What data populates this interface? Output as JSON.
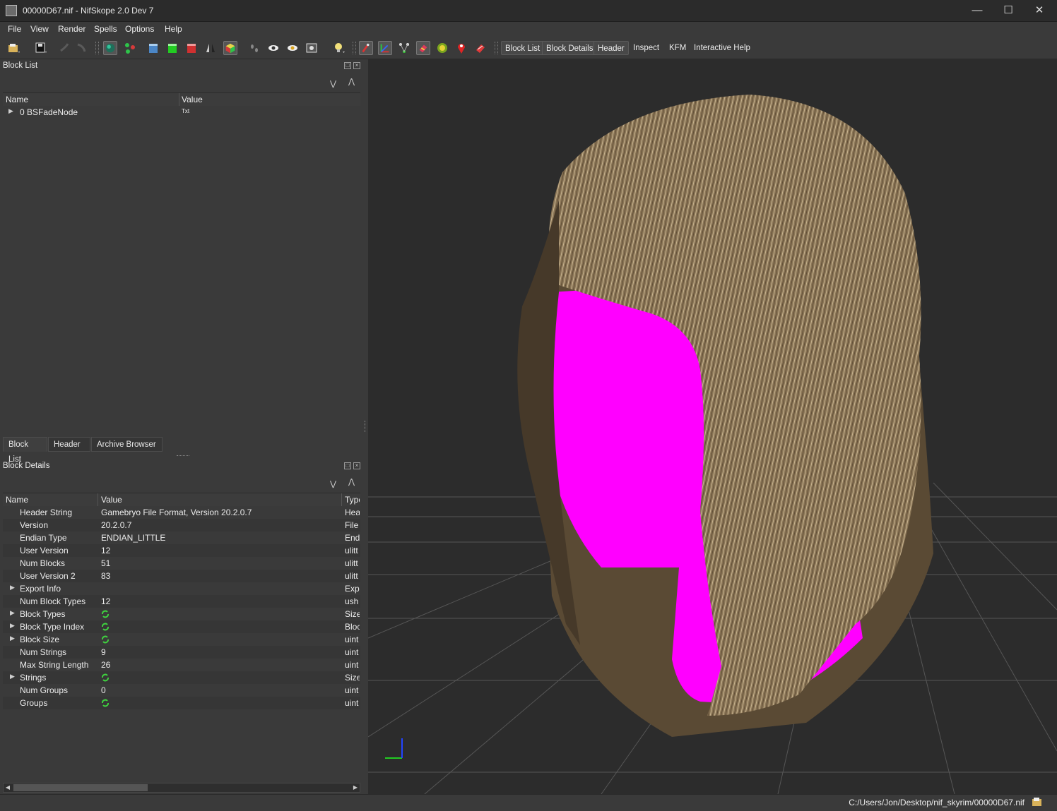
{
  "window": {
    "title": "00000D67.nif - NifSkope 2.0 Dev 7"
  },
  "menu": [
    "File",
    "View",
    "Render",
    "Spells",
    "Options",
    "Help"
  ],
  "toolbar": {
    "text_buttons": [
      "Block List",
      "Block Details",
      "Header",
      "Inspect",
      "KFM",
      "Interactive Help"
    ],
    "icons": [
      "open-icon",
      "save-icon",
      "undo-icon",
      "redo-icon",
      "globe-icon",
      "nodes-icon",
      "cube-front-icon",
      "cube-green-icon",
      "cube-red-icon",
      "flip-icon",
      "cube-color-icon",
      "footprints-icon",
      "eye-icon",
      "eye-yellow-icon",
      "camera-icon",
      "lightbulb-icon",
      "select-tool-icon",
      "axes-icon",
      "vertices-icon",
      "eraser-icon",
      "sphere-icon",
      "marker-icon",
      "shape-icon"
    ]
  },
  "block_list": {
    "title": "Block List",
    "columns": [
      "Name",
      "Value"
    ],
    "rows": [
      {
        "name": "0 BSFadeNode",
        "value": "Txt"
      }
    ]
  },
  "tabs": [
    "Block List",
    "Header",
    "Archive Browser"
  ],
  "block_details": {
    "title": "Block Details",
    "columns": [
      "Name",
      "Value",
      "Type"
    ],
    "rows": [
      {
        "name": "Header String",
        "value": "Gamebryo File Format, Version 20.2.0.7",
        "type": "Hea",
        "expandable": false,
        "icon": false
      },
      {
        "name": "Version",
        "value": "20.2.0.7",
        "type": "File",
        "expandable": false,
        "icon": false
      },
      {
        "name": "Endian Type",
        "value": "ENDIAN_LITTLE",
        "type": "End",
        "expandable": false,
        "icon": false
      },
      {
        "name": "User Version",
        "value": "12",
        "type": "ulitt",
        "expandable": false,
        "icon": false
      },
      {
        "name": "Num Blocks",
        "value": "51",
        "type": "ulitt",
        "expandable": false,
        "icon": false
      },
      {
        "name": "User Version 2",
        "value": "83",
        "type": "ulitt",
        "expandable": false,
        "icon": false
      },
      {
        "name": "Export Info",
        "value": "",
        "type": "Exp",
        "expandable": true,
        "icon": false
      },
      {
        "name": "Num Block Types",
        "value": "12",
        "type": "ush",
        "expandable": false,
        "icon": false
      },
      {
        "name": "Block Types",
        "value": "",
        "type": "Size",
        "expandable": true,
        "icon": true
      },
      {
        "name": "Block Type Index",
        "value": "",
        "type": "Bloc",
        "expandable": true,
        "icon": true
      },
      {
        "name": "Block Size",
        "value": "",
        "type": "uint",
        "expandable": true,
        "icon": true
      },
      {
        "name": "Num Strings",
        "value": "9",
        "type": "uint",
        "expandable": false,
        "icon": false
      },
      {
        "name": "Max String Length",
        "value": "26",
        "type": "uint",
        "expandable": false,
        "icon": false
      },
      {
        "name": "Strings",
        "value": "",
        "type": "Size",
        "expandable": true,
        "icon": true
      },
      {
        "name": "Num Groups",
        "value": "0",
        "type": "uint",
        "expandable": false,
        "icon": false
      },
      {
        "name": "Groups",
        "value": "",
        "type": "uint",
        "expandable": false,
        "icon": true
      }
    ]
  },
  "status": {
    "path": "C:/Users/Jon/Desktop/nif_skyrim/00000D67.nif"
  },
  "colors": {
    "viewport_bg": "#2c2c2c",
    "face": "#ff00ff",
    "hair": "#8a7556",
    "axis_x": "#22cc22",
    "axis_z": "#2244ff"
  }
}
